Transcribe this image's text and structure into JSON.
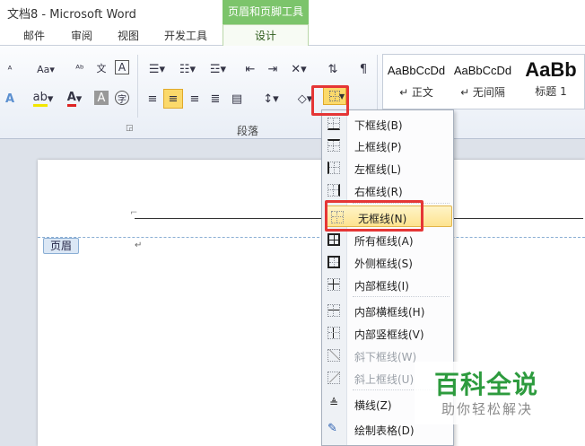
{
  "window": {
    "title": "文档8 - Microsoft Word",
    "context_tab_group": "页眉和页脚工具"
  },
  "tabs": [
    "邮件",
    "审阅",
    "视图",
    "开发工具",
    "设计"
  ],
  "ribbon": {
    "paragraph_group_label": "段落",
    "styles": [
      {
        "sample": "AaBbCcDd",
        "name": "↵ 正文"
      },
      {
        "sample": "AaBbCcDd",
        "name": "↵ 无间隔"
      },
      {
        "sample": "AaBb",
        "name": "标题 1"
      }
    ]
  },
  "document": {
    "header_tag": "页眉",
    "para_mark": "↵"
  },
  "border_menu": {
    "items": [
      {
        "label": "下框线(B)",
        "icon": "border-bottom-icon",
        "enabled": true
      },
      {
        "label": "上框线(P)",
        "icon": "border-top-icon",
        "enabled": true
      },
      {
        "label": "左框线(L)",
        "icon": "border-left-icon",
        "enabled": true
      },
      {
        "label": "右框线(R)",
        "icon": "border-right-icon",
        "enabled": true
      },
      {
        "label": "无框线(N)",
        "icon": "border-none-icon",
        "enabled": true,
        "highlighted": true
      },
      {
        "label": "所有框线(A)",
        "icon": "border-all-icon",
        "enabled": true
      },
      {
        "label": "外侧框线(S)",
        "icon": "border-outside-icon",
        "enabled": true
      },
      {
        "label": "内部框线(I)",
        "icon": "border-inside-icon",
        "enabled": true
      },
      {
        "label": "内部横框线(H)",
        "icon": "border-inside-horizontal-icon",
        "enabled": true
      },
      {
        "label": "内部竖框线(V)",
        "icon": "border-inside-vertical-icon",
        "enabled": true
      },
      {
        "label": "斜下框线(W)",
        "icon": "border-diagonal-down-icon",
        "enabled": false
      },
      {
        "label": "斜上框线(U)",
        "icon": "border-diagonal-up-icon",
        "enabled": false
      },
      {
        "label": "横线(Z)",
        "icon": "horizontal-line-icon",
        "enabled": true
      },
      {
        "label": "绘制表格(D)",
        "icon": "draw-table-icon",
        "enabled": true
      }
    ]
  },
  "watermark": {
    "brand": "百科全说",
    "slogan": "助你轻松解决"
  },
  "colors": {
    "accent_green": "#7cc46b",
    "highlight_red": "#e53636",
    "active_yellow": "#fbd96b"
  }
}
